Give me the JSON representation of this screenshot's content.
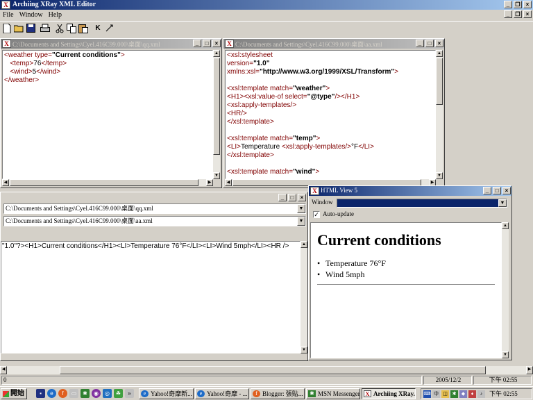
{
  "app": {
    "title": "Archiing XRay XML Editor",
    "menu": [
      "File",
      "Window",
      "Help"
    ],
    "toolbar_icons": [
      "new-file-icon",
      "open-folder-icon",
      "save-icon",
      "print-icon",
      "cut-icon",
      "copy-icon",
      "paste-icon",
      "transform-icon",
      "validate-icon"
    ]
  },
  "xml_window": {
    "title": "C:\\Documents and Settings\\Cyel.416C99.000\\桌面\\qq.xml",
    "lines": [
      [
        {
          "c": "tag",
          "t": "<weather "
        },
        {
          "c": "attr",
          "t": "type="
        },
        {
          "c": "val",
          "t": "\"Current conditions\""
        },
        {
          "c": "tag",
          "t": ">"
        }
      ],
      [
        {
          "c": "txt",
          "t": "   "
        },
        {
          "c": "tag",
          "t": "<temp>"
        },
        {
          "c": "txt",
          "t": "76"
        },
        {
          "c": "tag",
          "t": "</temp>"
        }
      ],
      [
        {
          "c": "txt",
          "t": "   "
        },
        {
          "c": "tag",
          "t": "<wind>"
        },
        {
          "c": "txt",
          "t": "5"
        },
        {
          "c": "tag",
          "t": "</wind>"
        }
      ],
      [
        {
          "c": "tag",
          "t": "</weather>"
        }
      ]
    ]
  },
  "xsl_window": {
    "title": "C:\\Documents and Settings\\Cyel.416C99.000\\桌面\\aa.xml",
    "lines": [
      [
        {
          "c": "tag",
          "t": "<xsl:stylesheet"
        }
      ],
      [
        {
          "c": "attr",
          "t": "version="
        },
        {
          "c": "val",
          "t": "\"1.0\""
        }
      ],
      [
        {
          "c": "attr",
          "t": "xmlns:xsl="
        },
        {
          "c": "val",
          "t": "\"http://www.w3.org/1999/XSL/Transform\""
        },
        {
          "c": "tag",
          "t": ">"
        }
      ],
      [],
      [
        {
          "c": "tag",
          "t": "<xsl:template "
        },
        {
          "c": "attr",
          "t": "match="
        },
        {
          "c": "val",
          "t": "\"weather\""
        },
        {
          "c": "tag",
          "t": ">"
        }
      ],
      [
        {
          "c": "tag",
          "t": "<H1><xsl:value-of "
        },
        {
          "c": "attr",
          "t": "select="
        },
        {
          "c": "val",
          "t": "\"@type\""
        },
        {
          "c": "tag",
          "t": "/></H1>"
        }
      ],
      [
        {
          "c": "tag",
          "t": "<xsl:apply-templates/>"
        }
      ],
      [
        {
          "c": "tag",
          "t": "<HR/>"
        }
      ],
      [
        {
          "c": "tag",
          "t": "</xsl:template>"
        }
      ],
      [],
      [
        {
          "c": "tag",
          "t": "<xsl:template "
        },
        {
          "c": "attr",
          "t": "match="
        },
        {
          "c": "val",
          "t": "\"temp\""
        },
        {
          "c": "tag",
          "t": ">"
        }
      ],
      [
        {
          "c": "tag",
          "t": "<LI>"
        },
        {
          "c": "txt",
          "t": "Temperature "
        },
        {
          "c": "tag",
          "t": "<xsl:apply-templates/>"
        },
        {
          "c": "txt",
          "t": "°F"
        },
        {
          "c": "tag",
          "t": "</LI>"
        }
      ],
      [
        {
          "c": "tag",
          "t": "</xsl:template>"
        }
      ],
      [],
      [
        {
          "c": "tag",
          "t": "<xsl:template "
        },
        {
          "c": "attr",
          "t": "match="
        },
        {
          "c": "val",
          "t": "\"wind\""
        },
        {
          "c": "tag",
          "t": ">"
        }
      ]
    ]
  },
  "transform_window": {
    "xml_path": "C:\\Documents and Settings\\Cyel.416C99.000\\桌面\\qq.xml",
    "xsl_path": "C:\\Documents and Settings\\Cyel.416C99.000\\桌面\\aa.xml",
    "output": "\"1.0\"?><H1>Current conditions</H1><LI>Temperature 76°F</LI><LI>Wind 5mph</LI><HR />"
  },
  "html_view": {
    "title": "HTML View 5",
    "window_label": "Window",
    "auto_update_label": "Auto-update",
    "auto_update_checked": true,
    "heading": "Current conditions",
    "items": [
      "Temperature 76°F",
      "Wind 5mph"
    ]
  },
  "status": {
    "left": "0",
    "date": "2005/12/2",
    "time": "下午 02:55"
  },
  "taskbar": {
    "start_label": "開始",
    "tasks": [
      "Yahoo!奇摩新...",
      "Yahoo!奇摩 - ...",
      "Blogger: 張貼...",
      "MSN Messenger",
      "Archiing XRay..."
    ],
    "tray_time": "下午 02:55"
  }
}
